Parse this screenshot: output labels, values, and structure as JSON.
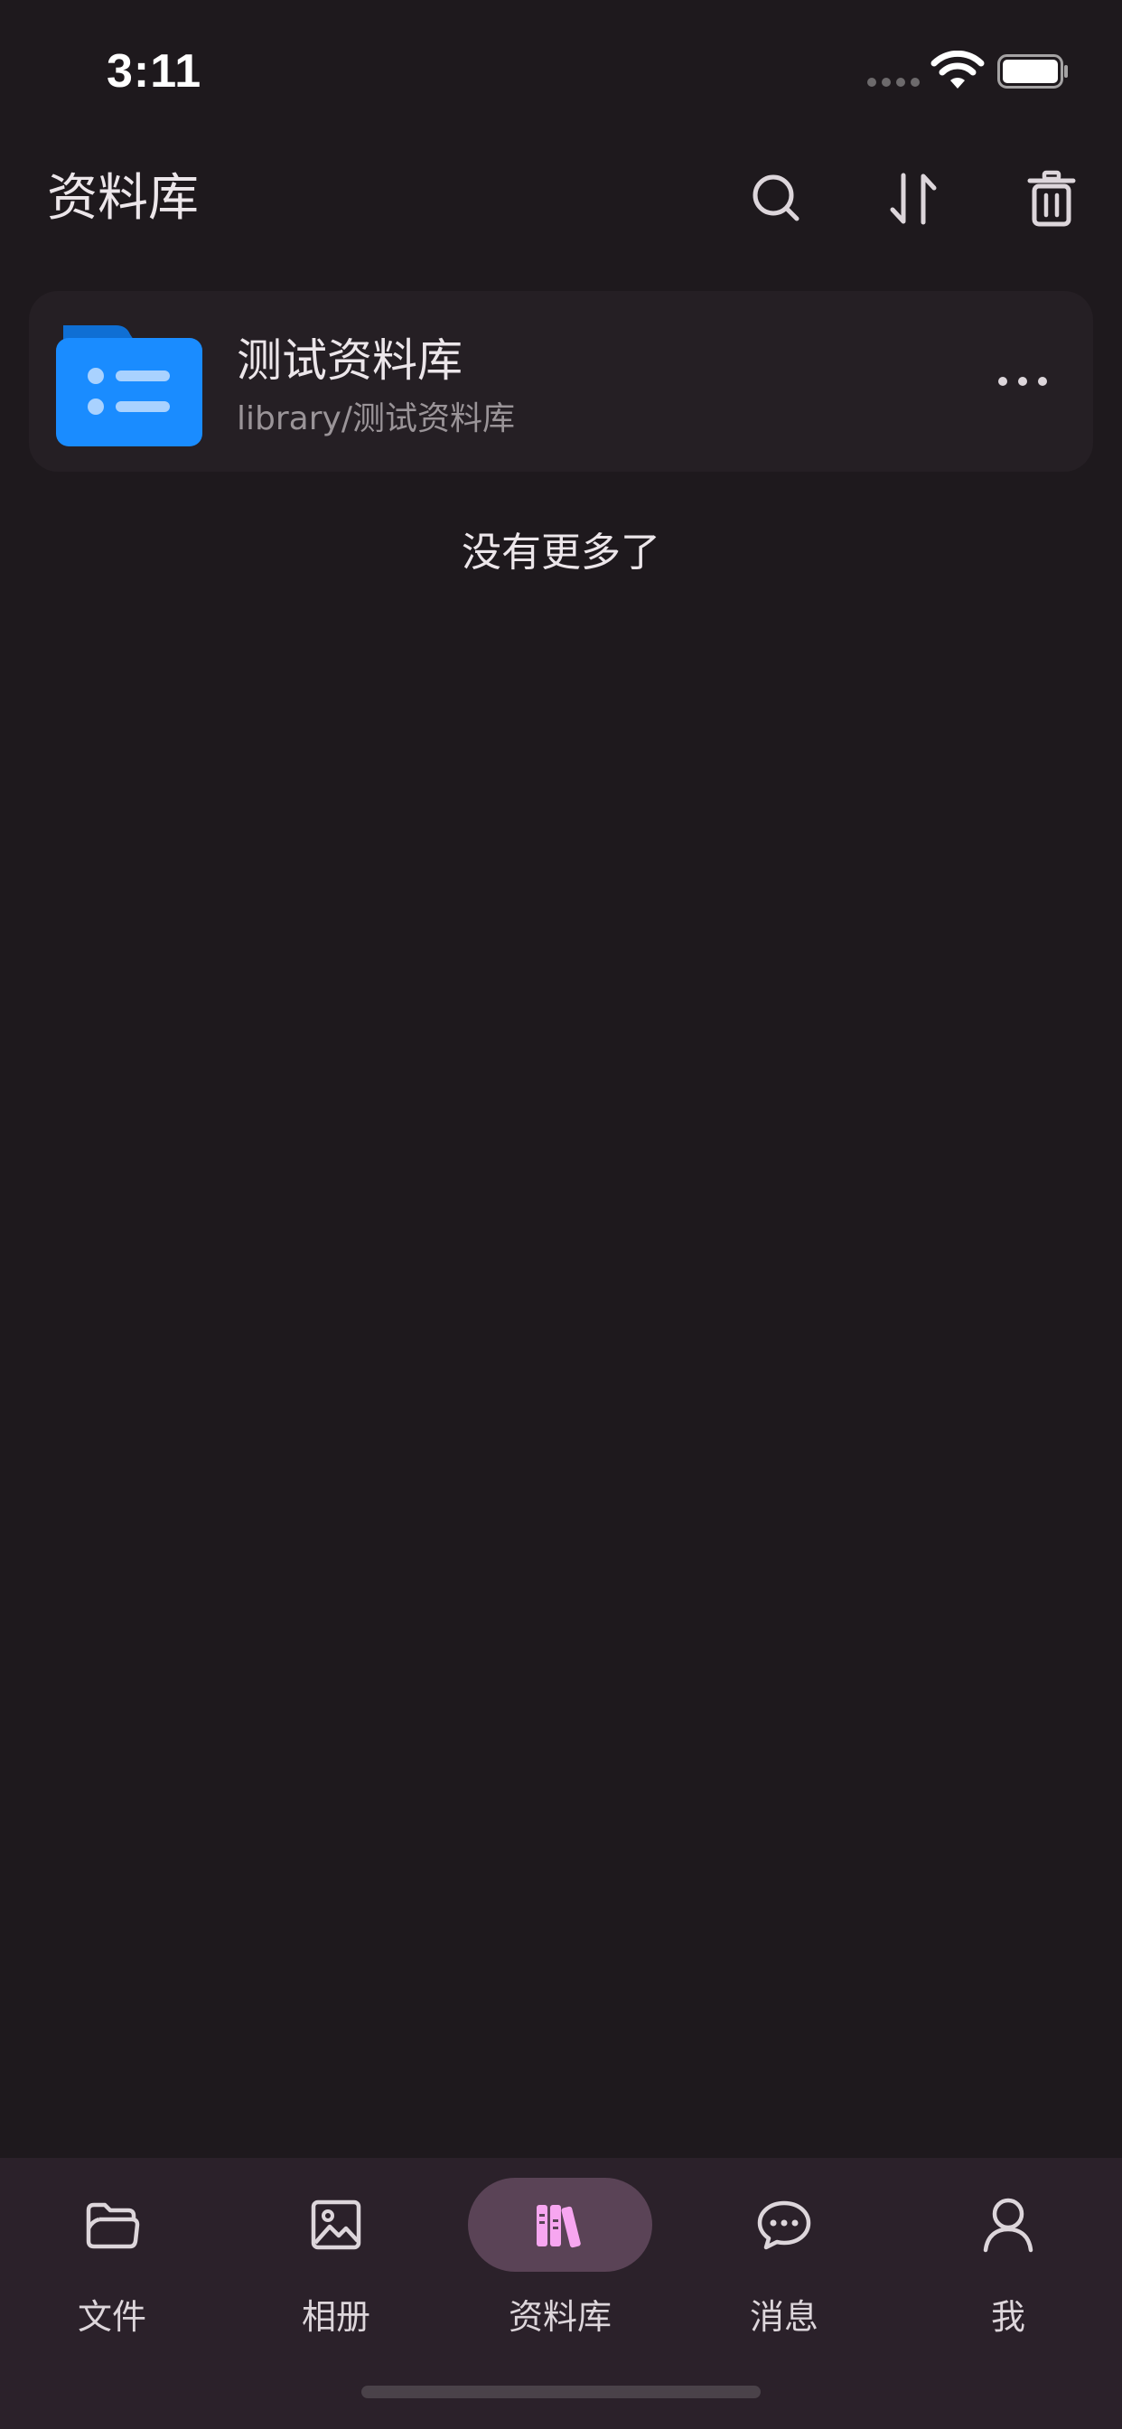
{
  "status_bar": {
    "time": "3:11",
    "icons": [
      "signal-icon",
      "wifi-icon",
      "battery-icon"
    ]
  },
  "header": {
    "title": "资料库",
    "actions": [
      "search-icon",
      "sort-icon",
      "trash-icon"
    ]
  },
  "library_list": {
    "items": [
      {
        "name": "测试资料库",
        "path": "library/测试资料库",
        "icon": "folder-icon"
      }
    ],
    "end_text": "没有更多了"
  },
  "bottom_nav": {
    "items": [
      {
        "label": "文件",
        "icon": "folder-open-icon",
        "active": false
      },
      {
        "label": "相册",
        "icon": "image-icon",
        "active": false
      },
      {
        "label": "资料库",
        "icon": "books-icon",
        "active": true
      },
      {
        "label": "消息",
        "icon": "chat-bubble-icon",
        "active": false
      },
      {
        "label": "我",
        "icon": "user-icon",
        "active": false
      }
    ]
  },
  "colors": {
    "background": "#1e191d",
    "card": "#251f24",
    "nav_background": "#2b212a",
    "nav_active_pill": "#5a4356",
    "active_icon": "#f7a6f0",
    "folder_blue": "#1a8cff",
    "text_primary": "#ece6ea",
    "text_secondary": "#9a9498"
  }
}
